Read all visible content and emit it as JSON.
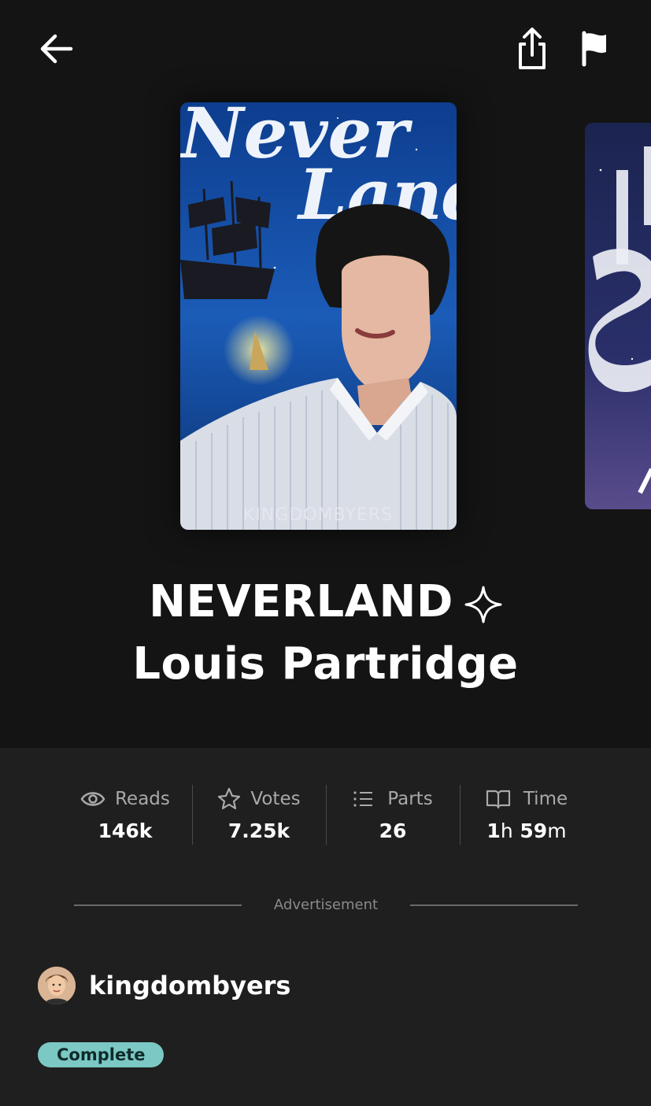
{
  "story": {
    "title_line1": "NEVERLAND",
    "title_line2": "Louis Partridge",
    "cover_watermark": "KINGDOMBYERS"
  },
  "stats": [
    {
      "label": "Reads",
      "icon": "eye-icon",
      "value": "146k"
    },
    {
      "label": "Votes",
      "icon": "star-icon",
      "value": "7.25k"
    },
    {
      "label": "Parts",
      "icon": "list-icon",
      "value": "26"
    },
    {
      "label": "Time",
      "icon": "book-icon",
      "value_num1": "1",
      "value_unit1": "h",
      "value_num2": "59",
      "value_unit2": "m"
    }
  ],
  "ad_label": "Advertisement",
  "author": {
    "name": "kingdombyers"
  },
  "status_badge": "Complete",
  "colors": {
    "background": "#141414",
    "stats_panel": "#1f1f1f",
    "badge": "#7bc8c4"
  }
}
